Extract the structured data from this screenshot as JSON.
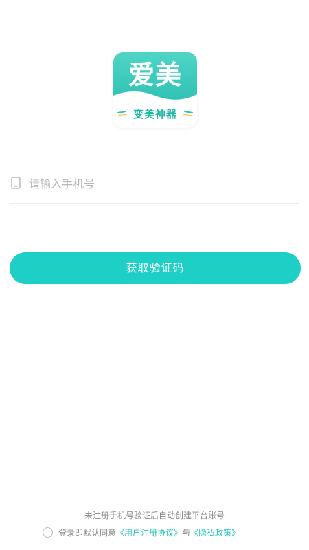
{
  "logo": {
    "title": "爱美",
    "subtitle": "变美神器",
    "brand_color": "#2fc2b3",
    "leaf_color": "#f0b93a"
  },
  "phone": {
    "icon": "phone-icon",
    "placeholder": "请输入手机号",
    "value": ""
  },
  "button": {
    "label": "获取验证码",
    "color": "#1dcfc4"
  },
  "footer": {
    "note": "未注册手机号验证后自动创建平台账号",
    "agree_prefix": "登录即默认同意",
    "user_agreement": "《用户注册协议》",
    "conjunction": "与",
    "privacy_policy": "《隐私政策》",
    "link_color": "#22c3b6"
  }
}
